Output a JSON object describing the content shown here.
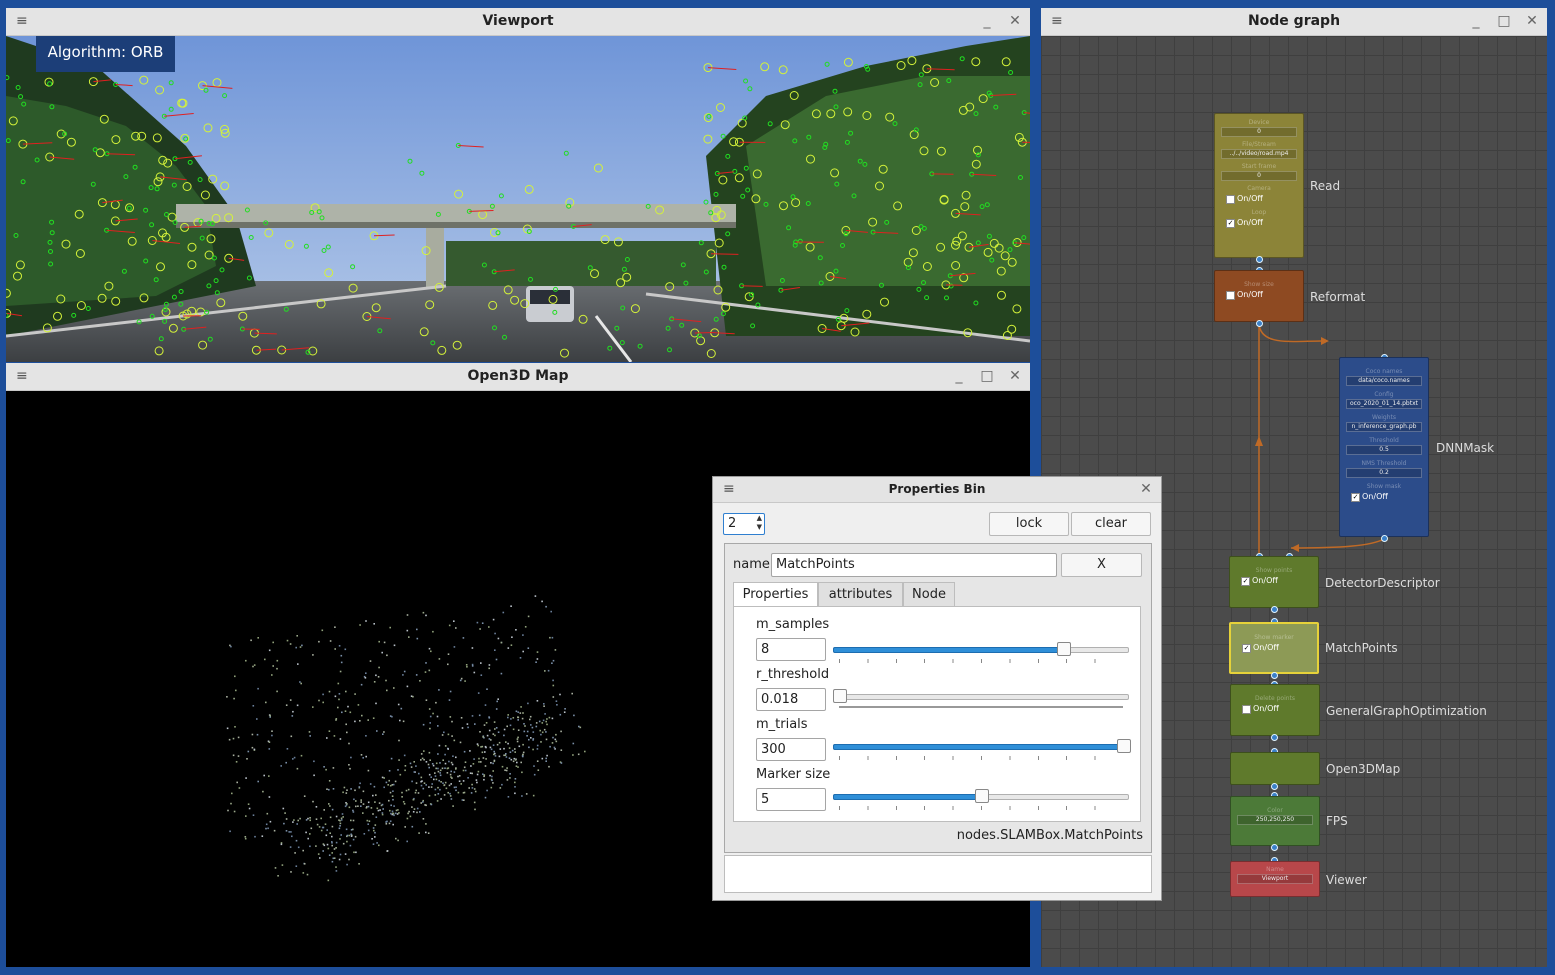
{
  "viewport": {
    "title": "Viewport",
    "algorithm_label": "Algorithm: ORB"
  },
  "map": {
    "title": "Open3D Map"
  },
  "node_graph": {
    "title": "Node graph",
    "nodes": [
      {
        "label": "Read",
        "color": "#8c8438",
        "fields": [
          {
            "name": "Device",
            "value": "0"
          },
          {
            "name": "File/Stream",
            "value": "../../video/road.mp4"
          },
          {
            "name": "Start frame",
            "value": "0"
          }
        ],
        "checks": [
          {
            "name": "Camera",
            "label": "On/Off",
            "checked": false
          },
          {
            "name": "Loop",
            "label": "On/Off",
            "checked": true
          }
        ]
      },
      {
        "label": "Reformat",
        "color": "#8e4a22",
        "checks": [
          {
            "name": "Show size",
            "label": "On/Off",
            "checked": false
          }
        ]
      },
      {
        "label": "DNNMask",
        "color": "#2c4c8a",
        "fields": [
          {
            "name": "Coco names",
            "value": "data/coco.names"
          },
          {
            "name": "Config",
            "value": "oco_2020_01_14.pbtxt"
          },
          {
            "name": "Weights",
            "value": "n_inference_graph.pb"
          },
          {
            "name": "Threshold",
            "value": "0.5"
          },
          {
            "name": "NMS Threshold",
            "value": "0.2"
          }
        ],
        "checks": [
          {
            "name": "Show mask",
            "label": "On/Off",
            "checked": true
          }
        ]
      },
      {
        "label": "DetectorDescriptor",
        "color": "#5f7a2c",
        "checks": [
          {
            "name": "Show points",
            "label": "On/Off",
            "checked": true
          }
        ]
      },
      {
        "label": "MatchPoints",
        "color": "#8d9a56",
        "checks": [
          {
            "name": "Show marker",
            "label": "On/Off",
            "checked": true
          }
        ]
      },
      {
        "label": "GeneralGraphOptimization",
        "color": "#5f7a2c",
        "checks": [
          {
            "name": "Delete points",
            "label": "On/Off",
            "checked": false
          }
        ]
      },
      {
        "label": "Open3DMap",
        "color": "#5f7a2c"
      },
      {
        "label": "FPS",
        "color": "#4c7a38",
        "fields": [
          {
            "name": "Color",
            "value": "250,250,250"
          }
        ]
      },
      {
        "label": "Viewer",
        "color": "#b8474a",
        "fields": [
          {
            "name": "Name",
            "value": "Viewport"
          }
        ]
      }
    ]
  },
  "properties_bin": {
    "title": "Properties Bin",
    "spin_value": "2",
    "lock_label": "lock",
    "clear_label": "clear",
    "name_label": "name",
    "name_value": "MatchPoints",
    "x_label": "X",
    "tabs": [
      "Properties",
      "attributes",
      "Node"
    ],
    "props": [
      {
        "label": "m_samples",
        "value": "8",
        "fraction": 0.79
      },
      {
        "label": "r_threshold",
        "value": "0.018",
        "fraction": 0.0
      },
      {
        "label": "m_trials",
        "value": "300",
        "fraction": 1.0
      },
      {
        "label": "Marker size",
        "value": "5",
        "fraction": 0.5
      }
    ],
    "node_path": "nodes.SLAMBox.MatchPoints"
  },
  "icons": {
    "menu": "≡",
    "minimize": "_",
    "maximize": "□",
    "close": "✕"
  }
}
